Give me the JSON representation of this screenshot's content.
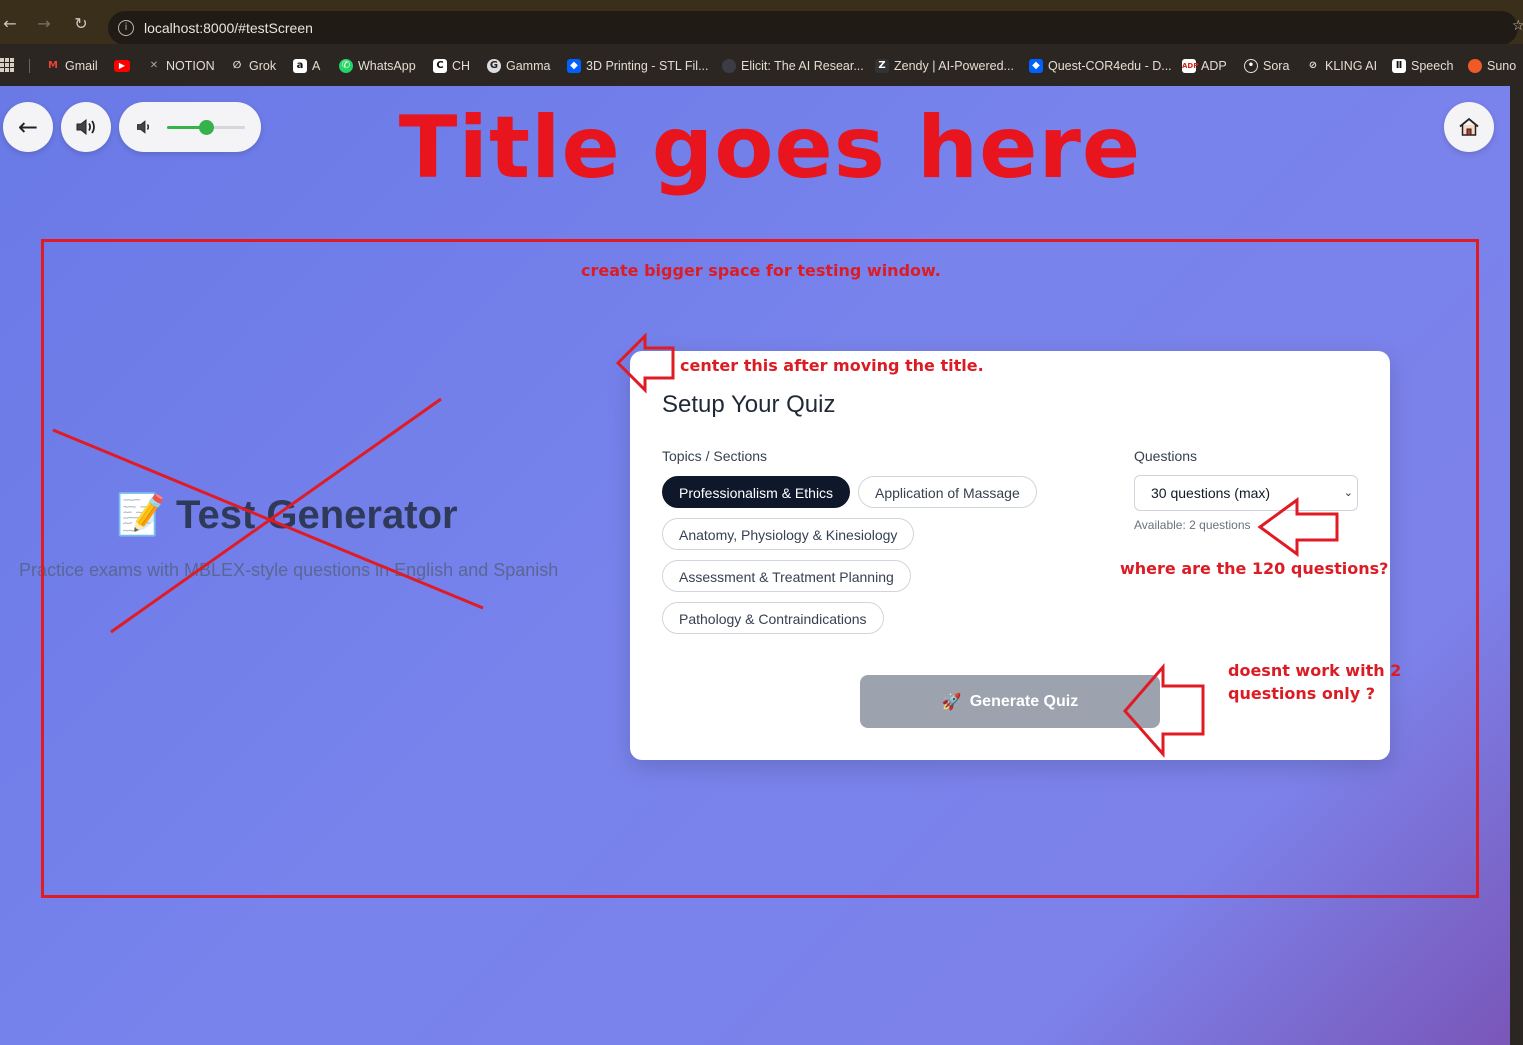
{
  "browser": {
    "url": "localhost:8000/#testScreen",
    "bookmarks": [
      {
        "label": "Gmail",
        "icon": "gmail-icon",
        "color": "#ea4335"
      },
      {
        "label": "",
        "icon": "youtube-icon",
        "color": "#ff0000"
      },
      {
        "label": "NOTION",
        "icon": "notion-icon",
        "color": "#9a9a9a"
      },
      {
        "label": "Grok",
        "icon": "grok-icon",
        "color": "#9a9a9a"
      },
      {
        "label": "A",
        "icon": "amazon-icon",
        "color": "#ffffff"
      },
      {
        "label": "WhatsApp",
        "icon": "whatsapp-icon",
        "color": "#25d366"
      },
      {
        "label": "CH",
        "icon": "ch-icon",
        "color": "#111111"
      },
      {
        "label": "Gamma",
        "icon": "gamma-icon",
        "color": "#cfcfcf"
      },
      {
        "label": "3D Printing - STL Fil...",
        "icon": "dropbox-icon",
        "color": "#0061fe"
      },
      {
        "label": "Elicit: The AI Resear...",
        "icon": "elicit-icon",
        "color": "#444444"
      },
      {
        "label": "Zendy | AI-Powered...",
        "icon": "zendy-icon",
        "color": "#333333"
      },
      {
        "label": "Quest-COR4edu - D...",
        "icon": "dropbox-icon",
        "color": "#0061fe"
      },
      {
        "label": "ADP",
        "icon": "adp-icon",
        "color": "#d0271d"
      },
      {
        "label": "Sora",
        "icon": "sora-icon",
        "color": "#cfcfcf"
      },
      {
        "label": "KLING AI",
        "icon": "kling-icon",
        "color": "#cfcfcf"
      },
      {
        "label": "Speech",
        "icon": "speech-icon",
        "color": "#ffffff"
      },
      {
        "label": "Suno",
        "icon": "suno-icon",
        "color": "#f05a28"
      }
    ]
  },
  "header": {
    "back_label": "←",
    "volume_level": 0.5,
    "home_icon": "home-icon",
    "title": "Title goes here"
  },
  "hero": {
    "emoji": "📝",
    "title": "Test Generator",
    "subtitle": "Practice exams with MBLEX-style questions in English and Spanish"
  },
  "quiz": {
    "title": "Setup Your Quiz",
    "topics_label": "Topics / Sections",
    "topics": [
      {
        "label": "Professionalism & Ethics",
        "selected": true
      },
      {
        "label": "Application of Massage",
        "selected": false
      },
      {
        "label": "Anatomy, Physiology & Kinesiology",
        "selected": false
      },
      {
        "label": "Assessment & Treatment Planning",
        "selected": false
      },
      {
        "label": "Pathology & Contraindications",
        "selected": false
      }
    ],
    "questions_label": "Questions",
    "questions_value": "30 questions (max)",
    "available": "Available: 2 questions",
    "generate_icon": "🚀",
    "generate_label": "Generate Quiz",
    "generate_enabled": false
  },
  "annotations": {
    "box_note": "create bigger space for testing window.",
    "center_note": "center this after moving the title.",
    "questions_note": "where are the 120 questions?",
    "generate_note_line1": "doesnt work with 2",
    "generate_note_line2": "questions only ?",
    "color": "#e01b24"
  }
}
